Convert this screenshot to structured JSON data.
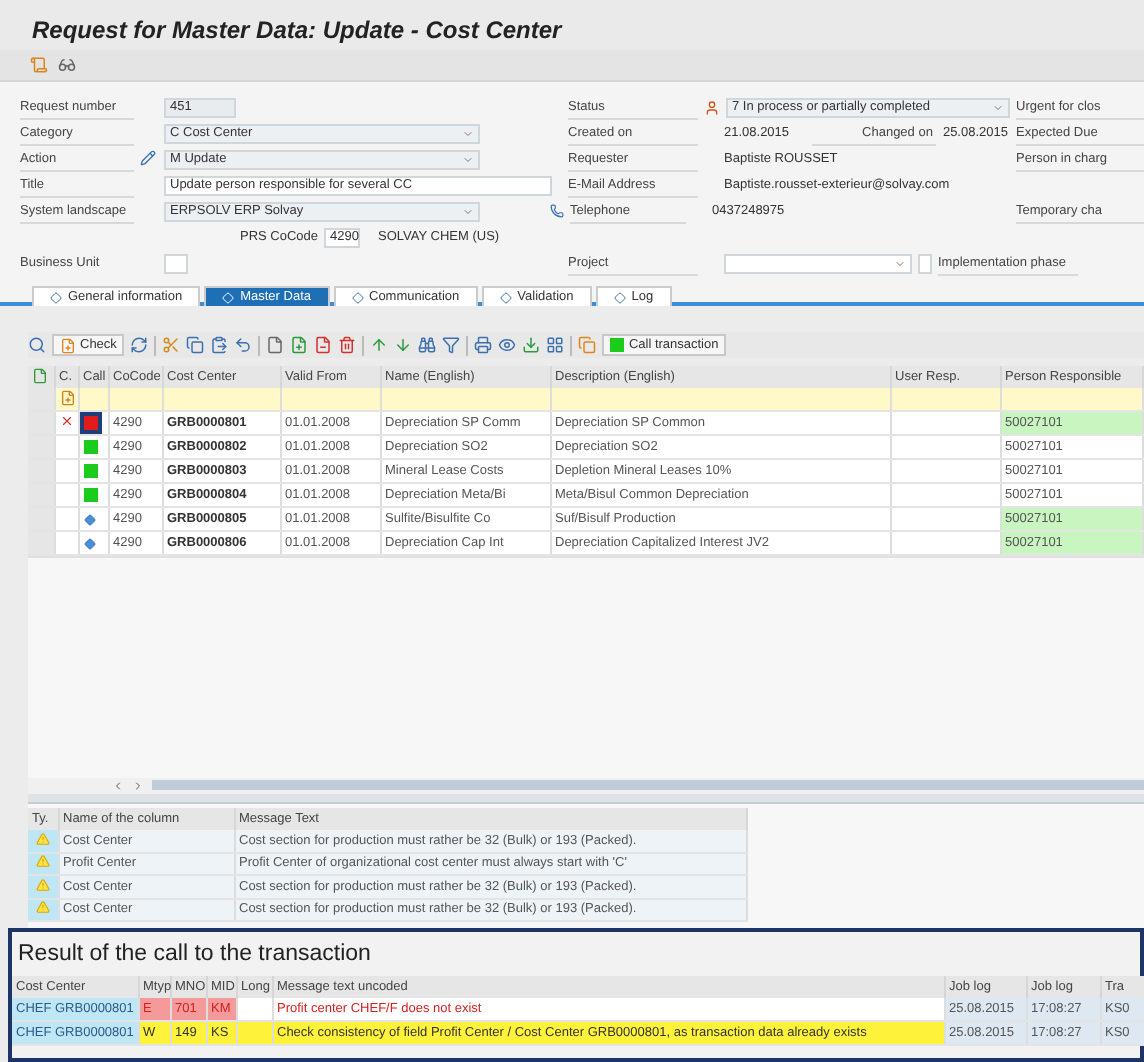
{
  "window": {
    "title": "Request for Master Data: Update - Cost Center"
  },
  "form": {
    "left": [
      {
        "label": "Request number",
        "kind": "display",
        "value": "451",
        "editable": false
      },
      {
        "label": "Category",
        "kind": "dropdown",
        "value": "C Cost Center",
        "editable": false
      },
      {
        "label": "Action",
        "kind": "dropdown",
        "value": "M Update",
        "editable": true
      },
      {
        "label": "Title",
        "kind": "input",
        "value": "Update person responsible for several CC",
        "editable": false
      },
      {
        "label": "System landscape",
        "kind": "dropdown",
        "value": "ERPSOLV ERP Solvay",
        "editable": false
      }
    ],
    "company": {
      "label": "PRS CoCode",
      "value": "4290",
      "name": "SOLVAY CHEM (US)"
    },
    "business_unit": {
      "label": "Business Unit"
    },
    "middle": [
      {
        "label": "Status",
        "kind": "status",
        "value": "7 In process or partially completed"
      },
      {
        "label": "Created on",
        "kind": "dates",
        "value": "21.08.2015",
        "extra_label": "Changed on",
        "extra_value": "25.08.2015"
      },
      {
        "label": "Requester",
        "kind": "text",
        "value": "Baptiste ROUSSET"
      },
      {
        "label": "E-Mail Address",
        "kind": "text",
        "value": "Baptiste.rousset-exterieur@solvay.com"
      },
      {
        "label": "Telephone",
        "kind": "phone",
        "value": "0437248975"
      }
    ],
    "project": {
      "label": "Project",
      "checkbox_label": "Implementation phase",
      "checked": false
    },
    "right": [
      "Urgent for clos",
      "Expected Due",
      "Person in charg",
      "Temporary cha"
    ]
  },
  "tabs": [
    {
      "label": "General information",
      "selected": false
    },
    {
      "label": "Master Data",
      "selected": true
    },
    {
      "label": "Communication",
      "selected": false
    },
    {
      "label": "Validation",
      "selected": false
    },
    {
      "label": "Log",
      "selected": false
    }
  ],
  "toolbar": {
    "check": "Check",
    "call": "Call transaction"
  },
  "table": {
    "columns": [
      "C.",
      "Call",
      "CoCode",
      "Cost Center",
      "Valid From",
      "Name (English)",
      "Description (English)",
      "User Resp.",
      "Person Responsible"
    ],
    "rows": [
      {
        "kind": "error",
        "selected": true,
        "error_mark": true,
        "cocode": "4290",
        "cost_center": "GRB0000801",
        "valid_from": "01.01.2008",
        "name": "Depreciation SP Comm",
        "description": "Depreciation SP Common",
        "person": "50027101",
        "changed": true
      },
      {
        "kind": "ok",
        "selected": false,
        "error_mark": false,
        "cocode": "4290",
        "cost_center": "GRB0000802",
        "valid_from": "01.01.2008",
        "name": "Depreciation SO2",
        "description": "Depreciation SO2",
        "person": "50027101",
        "changed": false
      },
      {
        "kind": "ok",
        "selected": false,
        "error_mark": false,
        "cocode": "4290",
        "cost_center": "GRB0000803",
        "valid_from": "01.01.2008",
        "name": "Mineral Lease Costs",
        "description": "Depletion Mineral Leases 10%",
        "person": "50027101",
        "changed": false
      },
      {
        "kind": "ok",
        "selected": false,
        "error_mark": false,
        "cocode": "4290",
        "cost_center": "GRB0000804",
        "valid_from": "01.01.2008",
        "name": "Depreciation Meta/Bi",
        "description": "Meta/Bisul Common Depreciation",
        "person": "50027101",
        "changed": false
      },
      {
        "kind": "info",
        "selected": false,
        "error_mark": false,
        "cocode": "4290",
        "cost_center": "GRB0000805",
        "valid_from": "01.01.2008",
        "name": "Sulfite/Bisulfite Co",
        "description": "Suf/Bisulf Production",
        "person": "50027101",
        "changed": true
      },
      {
        "kind": "info",
        "selected": false,
        "error_mark": false,
        "cocode": "4290",
        "cost_center": "GRB0000806",
        "valid_from": "01.01.2008",
        "name": "Depreciation Cap Int",
        "description": "Depreciation Capitalized Interest JV2",
        "person": "50027101",
        "changed": true
      }
    ]
  },
  "messages": {
    "columns": [
      "Ty.",
      "Name of the column",
      "Message Text"
    ],
    "rows": [
      {
        "kind": "warning",
        "column": "Cost Center",
        "text": "Cost section for production must rather be 32 (Bulk) or 193 (Packed)."
      },
      {
        "kind": "warning",
        "column": "Profit Center",
        "text": "Profit Center of organizational cost center must always start with 'C'"
      },
      {
        "kind": "warning",
        "column": "Cost Center",
        "text": "Cost section for production must rather be 32 (Bulk) or 193 (Packed)."
      },
      {
        "kind": "warning",
        "column": "Cost Center",
        "text": "Cost section for production must rather be 32 (Bulk) or 193 (Packed)."
      }
    ]
  },
  "result": {
    "title": "Result of the call to the transaction",
    "columns": [
      "Cost Center",
      "Mtyp",
      "MNO",
      "MID",
      "Long",
      "Message text uncoded",
      "Job log",
      "Job log",
      "Tra"
    ],
    "rows": [
      {
        "kind": "error",
        "cost_center": "CHEF GRB0000801",
        "mtyp": "E",
        "mno": "701",
        "mid": "KM",
        "text": "Profit center CHEF/F does not exist",
        "date": "25.08.2015",
        "time": "17:08:27",
        "tra": "KS0"
      },
      {
        "kind": "warning",
        "cost_center": "CHEF GRB0000801",
        "mtyp": "W",
        "mno": "149",
        "mid": "KS",
        "text": "Check consistency of field Profit Center / Cost Center GRB0000801, as transaction data already exists",
        "date": "25.08.2015",
        "time": "17:08:27",
        "tra": "KS0"
      }
    ]
  }
}
